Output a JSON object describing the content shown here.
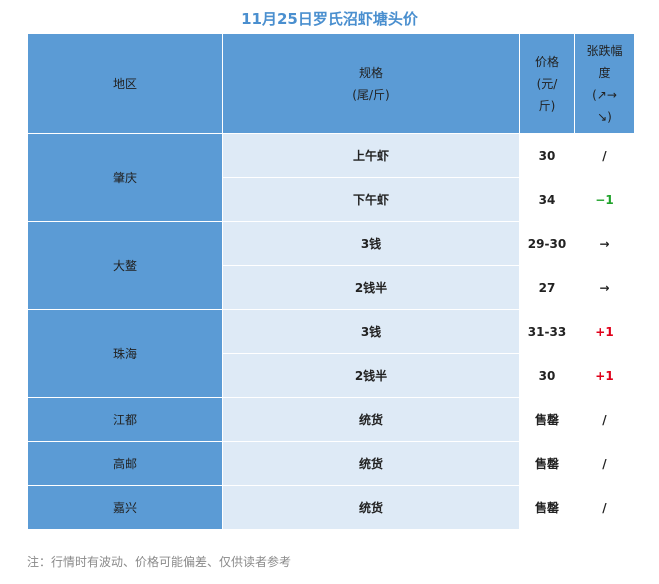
{
  "title": "11月25日罗氏沼虾塘头价",
  "header": {
    "region": "地区",
    "spec_line1": "规格",
    "spec_line2": "(尾/斤)",
    "price_line1": "价格",
    "price_line2": "(元/",
    "price_line3": "斤)",
    "change_line1": "张跌幅",
    "change_line2": "度",
    "change_line3": "(↗→",
    "change_line4": "↘)"
  },
  "rows": [
    {
      "region": "肇庆",
      "spec": "上午虾",
      "price": "30",
      "change": "/",
      "change_color": ""
    },
    {
      "spec": "下午虾",
      "price": "34",
      "change": "−1",
      "change_color": "#1fa32a"
    },
    {
      "region": "大鳌",
      "spec": "3钱",
      "price": "29-30",
      "change": "→",
      "change_color": ""
    },
    {
      "spec": "2钱半",
      "price": "27",
      "change": "→",
      "change_color": ""
    },
    {
      "region": "珠海",
      "spec": "3钱",
      "price": "31-33",
      "change": "+1",
      "change_color": "#e0001a"
    },
    {
      "spec": "2钱半",
      "price": "30",
      "change": "+1",
      "change_color": "#e0001a"
    },
    {
      "region": "江都",
      "spec": "统货",
      "price": "售罄",
      "change": "/",
      "change_color": ""
    },
    {
      "region": "高邮",
      "spec": "统货",
      "price": "售罄",
      "change": "/",
      "change_color": ""
    },
    {
      "region": "嘉兴",
      "spec": "统货",
      "price": "售罄",
      "change": "/",
      "change_color": ""
    }
  ],
  "note": "注：行情时有波动、价格可能偏差、仅供读者参考",
  "colors": {
    "header_bg": "#5b9bd5",
    "spec_bg": "#deeaf6",
    "title": "#4a8fcf",
    "up": "#e0001a",
    "down": "#1fa32a"
  }
}
